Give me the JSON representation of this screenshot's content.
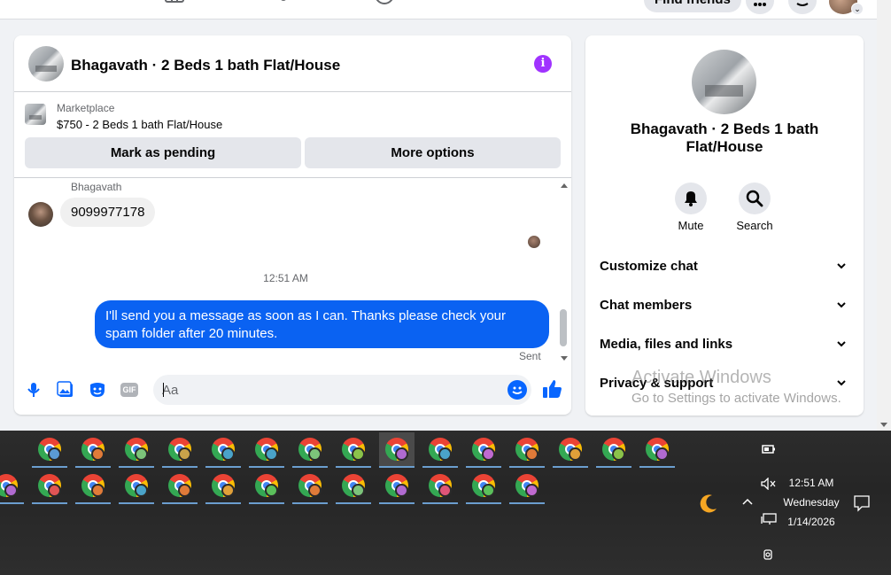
{
  "topnav": {
    "find_friends": "Find friends"
  },
  "chat": {
    "header_title": "Bhagavath · 2 Beds 1 bath Flat/House",
    "marketplace_label": "Marketplace",
    "listing_title": "$750 - 2 Beds 1 bath Flat/House",
    "mark_pending": "Mark as pending",
    "more_options": "More options",
    "messages": {
      "sender_name": "Bhagavath",
      "incoming_text": "9099977178",
      "timestamp": "12:51 AM",
      "outgoing_text": "I'll send you a message as soon as I can. Thanks please check your spam folder after 20 minutes.",
      "status": "Sent"
    },
    "composer": {
      "placeholder": "Aa",
      "gif_label": "GIF"
    }
  },
  "info_panel": {
    "title": "Bhagavath · 2 Beds 1 bath Flat/House",
    "mute_label": "Mute",
    "search_label": "Search",
    "sections": [
      "Customize chat",
      "Chat members",
      "Media, files and links",
      "Privacy & support"
    ]
  },
  "watermark": {
    "line1": "Activate Windows",
    "line2": "Go to Settings to activate Windows."
  },
  "taskbar": {
    "row1_profile_colors": [
      "#5b9bd5",
      "#e07b39",
      "#7cc47a",
      "#c9a24a",
      "#4aa3c9",
      "#4aa3c9",
      "#7cc47a",
      "#8bc34a",
      "#b06ad0",
      "#4aa3c9",
      "#c06ad0",
      "#e07b39",
      "#e0a039",
      "#8bc34a",
      "#b06ad0"
    ],
    "row2_profile_colors": [
      "#b06ad0",
      "#e05555",
      "#e07b39",
      "#4aa3c9",
      "#e07b39",
      "#e0a039",
      "#5bbf5b",
      "#e07b39",
      "#7cc47a",
      "#b06ad0",
      "#e05577",
      "#5bbf5b",
      "#c06ad0"
    ],
    "clock_time": "12:51 AM",
    "clock_day": "Wednesday",
    "clock_date": "1/14/2026"
  }
}
